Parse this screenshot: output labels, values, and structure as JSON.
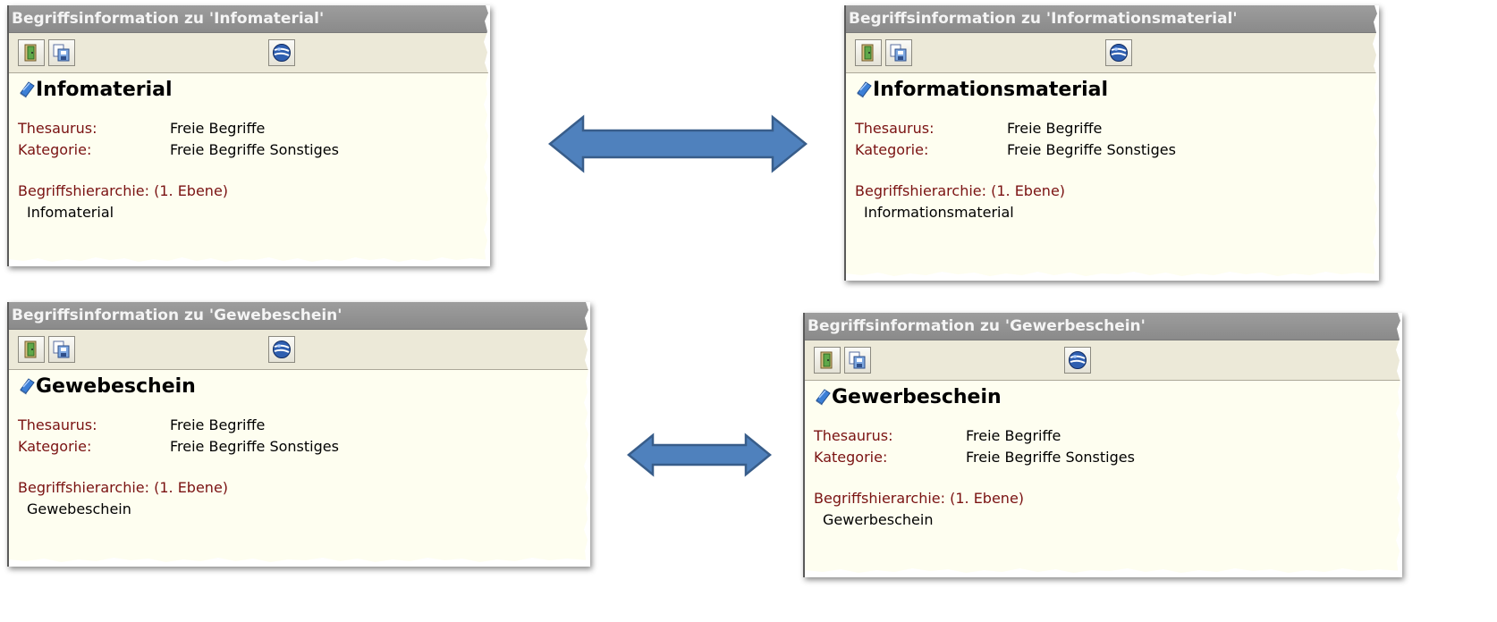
{
  "panels": [
    {
      "title": "Begriffsinformation zu 'Infomaterial'",
      "term": "Infomaterial",
      "thesaurus_label": "Thesaurus:",
      "thesaurus_value": "Freie Begriffe",
      "kategorie_label": "Kategorie:",
      "kategorie_value": "Freie Begriffe Sonstiges",
      "hierarchy_label": "Begriffshierarchie: (1. Ebene)",
      "hierarchy_item": "Infomaterial"
    },
    {
      "title": "Begriffsinformation zu 'Informationsmaterial'",
      "term": "Informationsmaterial",
      "thesaurus_label": "Thesaurus:",
      "thesaurus_value": "Freie Begriffe",
      "kategorie_label": "Kategorie:",
      "kategorie_value": "Freie Begriffe Sonstiges",
      "hierarchy_label": "Begriffshierarchie: (1. Ebene)",
      "hierarchy_item": "Informationsmaterial"
    },
    {
      "title": "Begriffsinformation zu 'Gewebeschein'",
      "term": "Gewebeschein",
      "thesaurus_label": "Thesaurus:",
      "thesaurus_value": "Freie Begriffe",
      "kategorie_label": "Kategorie:",
      "kategorie_value": "Freie Begriffe Sonstiges",
      "hierarchy_label": "Begriffshierarchie: (1. Ebene)",
      "hierarchy_item": "Gewebeschein"
    },
    {
      "title": "Begriffsinformation zu 'Gewerbeschein'",
      "term": "Gewerbeschein",
      "thesaurus_label": "Thesaurus:",
      "thesaurus_value": "Freie Begriffe",
      "kategorie_label": "Kategorie:",
      "kategorie_value": "Freie Begriffe Sonstiges",
      "hierarchy_label": "Begriffshierarchie: (1. Ebene)",
      "hierarchy_item": "Gewerbeschein"
    }
  ],
  "icons": {
    "toolbar_1": "exit-door-icon",
    "toolbar_2": "copy-save-icon",
    "toolbar_3": "globe-icon",
    "term": "blue-book-icon",
    "connector": "double-headed-arrow-icon"
  },
  "colors": {
    "title_bar": "#8f8f8f",
    "content_bg": "#fefef0",
    "label": "#7a1212",
    "arrow_fill": "#4f81bd",
    "arrow_stroke": "#385d8a"
  }
}
